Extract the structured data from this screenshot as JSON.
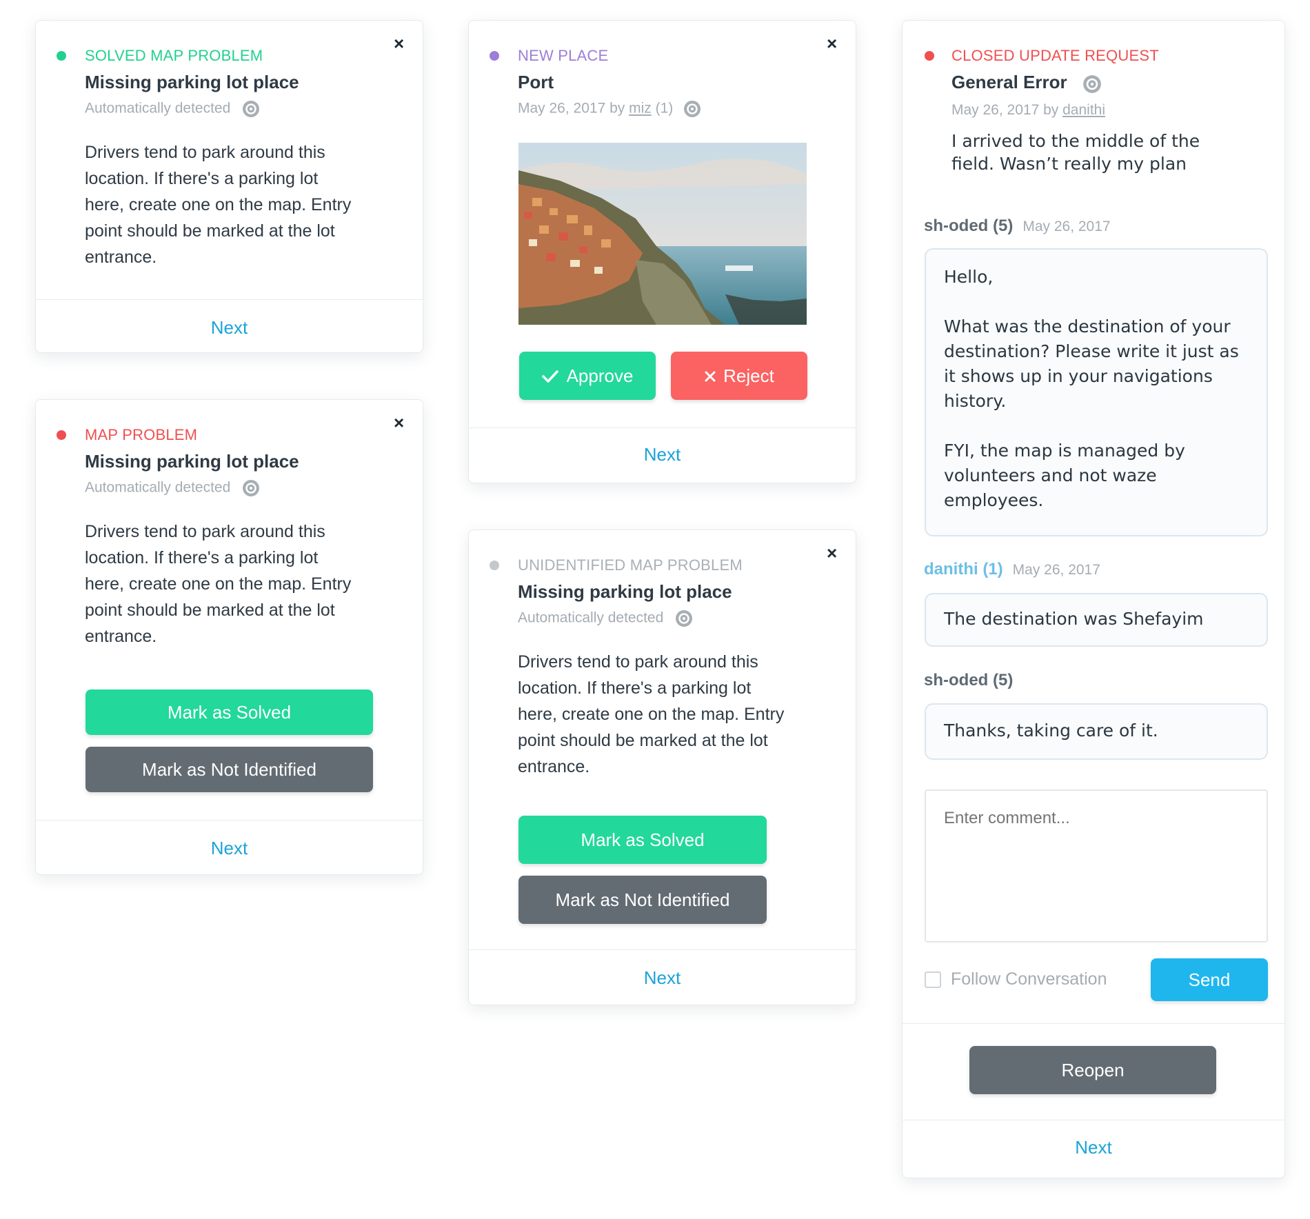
{
  "cards": {
    "solved": {
      "type_label": "SOLVED MAP PROBLEM",
      "status_color": "#22d18f",
      "title": "Missing parking lot place",
      "meta": "Automatically detected",
      "description": "Drivers tend to park around this location. If there's a parking lot here, create one on the map. Entry point should be marked at the lot entrance.",
      "next_label": "Next",
      "close_glyph": "×"
    },
    "map_problem": {
      "type_label": "MAP PROBLEM",
      "status_color": "#f04f4f",
      "title": "Missing parking lot place",
      "meta": "Automatically detected",
      "description": "Drivers tend to park around this location. If there's a parking lot here, create one on the map. Entry point should be marked at the lot entrance.",
      "solve_label": "Mark as Solved",
      "not_identified_label": "Mark as Not Identified",
      "next_label": "Next",
      "close_glyph": "×"
    },
    "new_place": {
      "type_label": "NEW PLACE",
      "status_color": "#9c7ed8",
      "title": "Port",
      "meta_prefix": "May 26, 2017 by",
      "meta_user": "miz",
      "meta_suffix": "(1)",
      "approve_label": "Approve",
      "reject_label": "Reject",
      "next_label": "Next",
      "close_glyph": "×"
    },
    "unidentified": {
      "type_label": "UNIDENTIFIED MAP PROBLEM",
      "status_color": "#c3c8cd",
      "title": "Missing parking lot place",
      "meta": "Automatically detected",
      "description": "Drivers tend to park around this location. If there's a parking lot here, create one on the map. Entry point should be marked at the lot entrance.",
      "solve_label": "Mark as Solved",
      "not_identified_label": "Mark as Not Identified",
      "next_label": "Next",
      "close_glyph": "×"
    },
    "update_request": {
      "type_label": "CLOSED UPDATE REQUEST",
      "status_color": "#f04f4f",
      "title": "General Error",
      "meta_prefix": "May 26, 2017 by",
      "meta_user": "danithi",
      "description": "I arrived to the middle of the field. Wasn’t really my plan",
      "conversation": [
        {
          "author": "sh-oded (5)",
          "date": "May 26, 2017",
          "author_color": "#5f6a73",
          "paragraphs": [
            "Hello,",
            "What was the destination of your destination? Please write it just as it shows up in your navigations history.",
            "FYI, the map is managed by volunteers and not waze employees."
          ]
        },
        {
          "author": "danithi (1)",
          "date": "May 26, 2017",
          "author_color": "#6cbfe6",
          "paragraphs": [
            "The destination was Shefayim"
          ]
        },
        {
          "author": "sh-oded (5)",
          "date": "",
          "author_color": "#5f6a73",
          "paragraphs": [
            "Thanks, taking care of it."
          ]
        }
      ],
      "comment_placeholder": "Enter comment...",
      "follow_label": "Follow Conversation",
      "follow_checked": false,
      "send_label": "Send",
      "reopen_label": "Reopen",
      "next_label": "Next"
    }
  },
  "icons": {
    "close": "close-icon",
    "gear": "gear-icon",
    "check": "check-icon",
    "reject": "x-icon"
  }
}
